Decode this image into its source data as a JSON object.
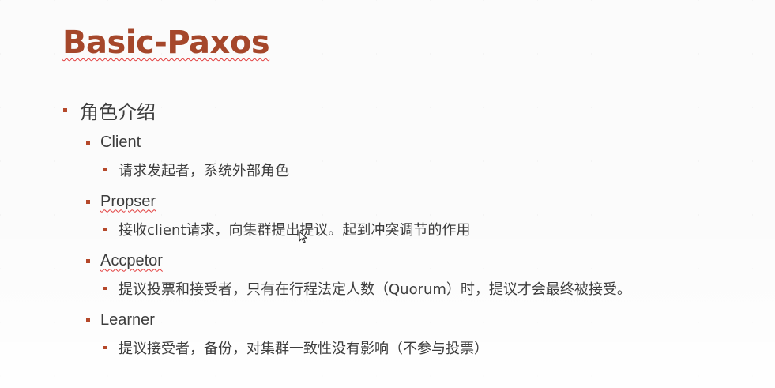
{
  "slide": {
    "title": "Basic-Paxos",
    "section": "角色介绍",
    "roles": [
      {
        "name": "Client",
        "desc": "请求发起者，系统外部角色"
      },
      {
        "name": "Propser",
        "desc": "接收client请求，向集群提出提议。起到冲突调节的作用"
      },
      {
        "name": "Accpetor",
        "desc": "提议投票和接受者，只有在行程法定人数（Quorum）时，提议才会最终被接受。"
      },
      {
        "name": "Learner",
        "desc": "提议接受者，备份，对集群一致性没有影响（不参与投票）"
      }
    ]
  },
  "colors": {
    "title": "#a5472b",
    "bullet": "#b5482a",
    "text": "#3d3d3d"
  },
  "icons": {
    "pointer": "mouse-cursor-icon"
  }
}
